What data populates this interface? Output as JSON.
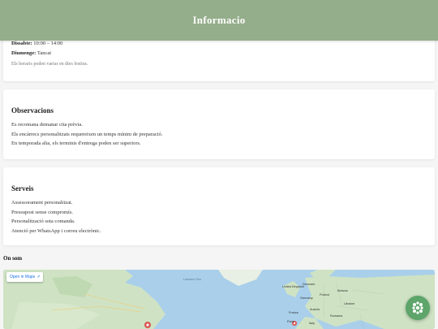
{
  "header": {
    "title": "Informacio"
  },
  "hours": {
    "rows": [
      {
        "day": "Dissabte:",
        "value": "10:00 – 14:00"
      },
      {
        "day": "Diumenge:",
        "value": "Tancat"
      }
    ],
    "note": "Els horaris poden variar en dies festius."
  },
  "observations": {
    "title": "Observacions",
    "lines": [
      "Es recomana demanar cita prèvia.",
      "Els encàrrecs personalitzats requereixen un temps mínim de preparació.",
      "En temporada alta, els terminis d'entrega poden ser superiors."
    ]
  },
  "services": {
    "title": "Serveis",
    "lines": [
      "Assessorament personalitzat.",
      "Pressupost sense compromís.",
      "Personalització sota comanda.",
      "Atenció per WhatsApp i correu electrònic."
    ]
  },
  "about": {
    "title": "On som"
  },
  "map": {
    "open_label": "Open in Maps",
    "labels": [
      "Labrador Sea",
      "United Kingdom",
      "Denmark",
      "Belarus",
      "Poland",
      "Germany",
      "Ukraine",
      "France",
      "Austria",
      "Romania",
      "Paris",
      "Italy"
    ]
  },
  "colors": {
    "header": "#94ad8a",
    "fab": "#5da56a",
    "water": "#a9cfea",
    "land": "#cfe3c4"
  }
}
